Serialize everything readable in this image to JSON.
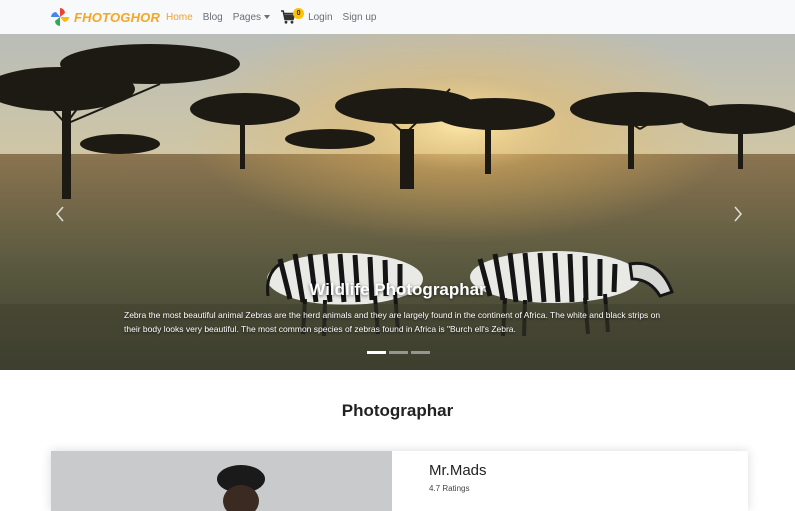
{
  "navbar": {
    "brand": "FHOTOGHOR",
    "links": [
      {
        "label": "Home",
        "active": true
      },
      {
        "label": "Blog"
      },
      {
        "label": "Pages",
        "dropdown": true
      }
    ],
    "cart_count": "0",
    "login": "Login",
    "signup": "Sign up"
  },
  "carousel": {
    "title": "Wildlife Photographar",
    "text": "Zebra the most beautiful animal Zebras are the herd animals and they are largely found in the continent of Africa. The white and black strips on their body looks very beautiful. The most common species of zebras found in Africa is \"Burch ell's Zebra.",
    "prev_icon": "chevron-left-icon",
    "next_icon": "chevron-right-icon",
    "slides": 3,
    "active_slide": 1
  },
  "section": {
    "title": "Photographar"
  },
  "card": {
    "name": "Mr.Mads",
    "rating": "4.7 Ratings"
  },
  "colors": {
    "brand": "#f5a623",
    "active_link": "#f0a030",
    "badge": "#ffc107"
  }
}
